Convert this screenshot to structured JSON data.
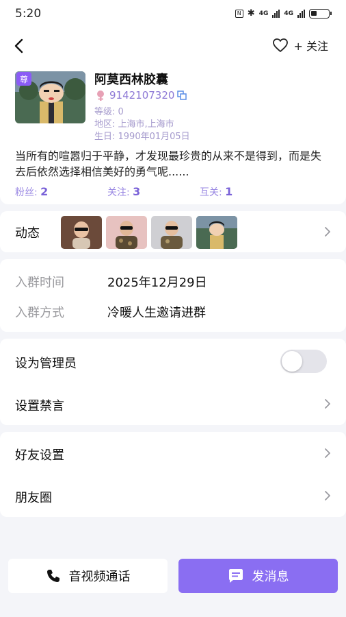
{
  "status_bar": {
    "time": "5:20",
    "signal_1": "4G",
    "signal_2": "4G"
  },
  "nav": {
    "follow_label": "+ 关注"
  },
  "profile": {
    "name": "阿莫西林胶囊",
    "user_id": "9142107320",
    "level": "等级: 0",
    "region": "地区: 上海市,上海市",
    "birthday": "生日: 1990年01月05日",
    "badge_text": "尊",
    "bio": "当所有的喧嚣归于平静，才发现最珍贵的从来不是得到，而是失去后依然选择相信美好的勇气呢......",
    "stats": [
      {
        "label": "粉丝: ",
        "value": "2"
      },
      {
        "label": "关注: ",
        "value": "3"
      },
      {
        "label": "互关: ",
        "value": "1"
      }
    ]
  },
  "moments": {
    "label": "动态",
    "thumbnails": [
      "baby-sunglasses-photo",
      "baby-camo-sunglasses-photo",
      "baby-sitting-sunglasses-photo",
      "cartoon-avatar-photo"
    ]
  },
  "group_info": {
    "join_time_label": "入群时间",
    "join_time_value": "2025年12月29日",
    "join_method_label": "入群方式",
    "join_method_value": "冷暖人生邀请进群"
  },
  "admin": {
    "set_admin_label": "设为管理员",
    "set_admin_enabled": false,
    "mute_label": "设置禁言"
  },
  "friend": {
    "friend_settings_label": "好友设置",
    "moments_circle_label": "朋友圈"
  },
  "actions": {
    "call_label": "音视频通话",
    "message_label": "发消息"
  },
  "colors": {
    "accent": "#8a6ef2",
    "accent_text": "#7a62d8",
    "meta_text": "#a59acd",
    "background": "#f4f5f9"
  }
}
